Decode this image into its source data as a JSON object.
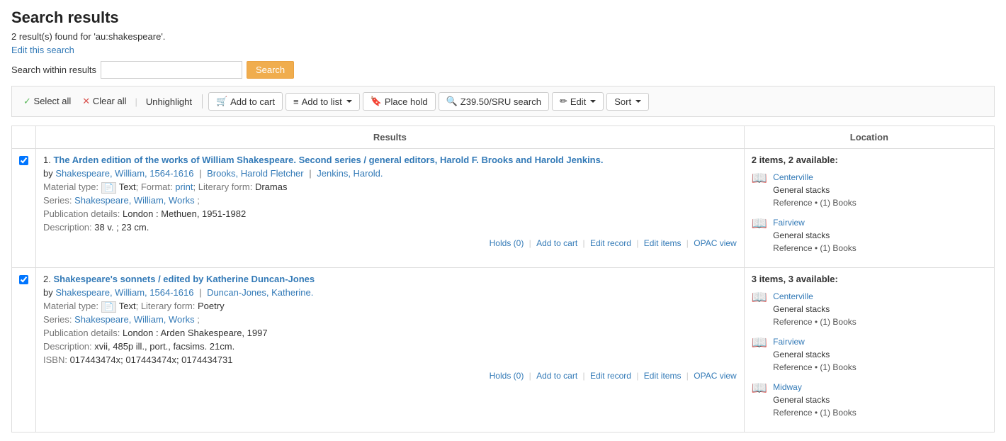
{
  "page": {
    "title": "Search results",
    "result_count": "2 result(s) found for 'au:shakespeare'.",
    "edit_search_label": "Edit this search",
    "search_within_label": "Search within results",
    "search_btn_label": "Search",
    "search_input_value": ""
  },
  "toolbar": {
    "select_all_label": "Select all",
    "clear_all_label": "Clear all",
    "unhighlight_label": "Unhighlight",
    "add_to_cart_label": "Add to cart",
    "add_to_list_label": "Add to list",
    "place_hold_label": "Place hold",
    "z3950_label": "Z39.50/SRU search",
    "edit_label": "Edit",
    "sort_label": "Sort"
  },
  "results_header": "Results",
  "location_header": "Location",
  "results": [
    {
      "number": "1.",
      "title": "The Arden edition of the works of William Shakespeare. Second series / general editors, Harold F. Brooks and Harold Jenkins.",
      "authors": [
        {
          "name": "Shakespeare, William, 1564-1616",
          "link": true
        },
        {
          "name": "Brooks, Harold Fletcher",
          "link": true
        },
        {
          "name": "Jenkins, Harold.",
          "link": true
        }
      ],
      "material_type": "Text",
      "format": "print",
      "literary_form": "Dramas",
      "series": "Shakespeare, William, Works",
      "publication": "London : Methuen, 1951-1982",
      "description": "38 v. ; 23 cm.",
      "holds": "Holds (0)",
      "add_to_cart": "Add to cart",
      "edit_record": "Edit record",
      "edit_items": "Edit items",
      "opac_view": "OPAC view",
      "location_summary": "2 items, 2 available:",
      "locations": [
        {
          "name": "Centerville",
          "stacks": "General stacks",
          "ref": "Reference • (1) Books"
        },
        {
          "name": "Fairview",
          "stacks": "General stacks",
          "ref": "Reference • (1) Books"
        }
      ]
    },
    {
      "number": "2.",
      "title": "Shakespeare's sonnets / edited by Katherine Duncan-Jones",
      "authors": [
        {
          "name": "Shakespeare, William, 1564-1616",
          "link": true
        },
        {
          "name": "Duncan-Jones, Katherine.",
          "link": true
        }
      ],
      "material_type": "Text",
      "format": null,
      "literary_form": "Poetry",
      "series": "Shakespeare, William, Works",
      "publication": "London : Arden Shakespeare, 1997",
      "description": "xvii, 485p ill., port., facsims. 21cm.",
      "isbn": "017443474x; 017443474x; 0174434731",
      "holds": "Holds (0)",
      "add_to_cart": "Add to cart",
      "edit_record": "Edit record",
      "edit_items": "Edit items",
      "opac_view": "OPAC view",
      "location_summary": "3 items, 3 available:",
      "locations": [
        {
          "name": "Centerville",
          "stacks": "General stacks",
          "ref": "Reference • (1) Books"
        },
        {
          "name": "Fairview",
          "stacks": "General stacks",
          "ref": "Reference • (1) Books"
        },
        {
          "name": "Midway",
          "stacks": "General stacks",
          "ref": "Reference • (1) Books"
        }
      ]
    }
  ]
}
